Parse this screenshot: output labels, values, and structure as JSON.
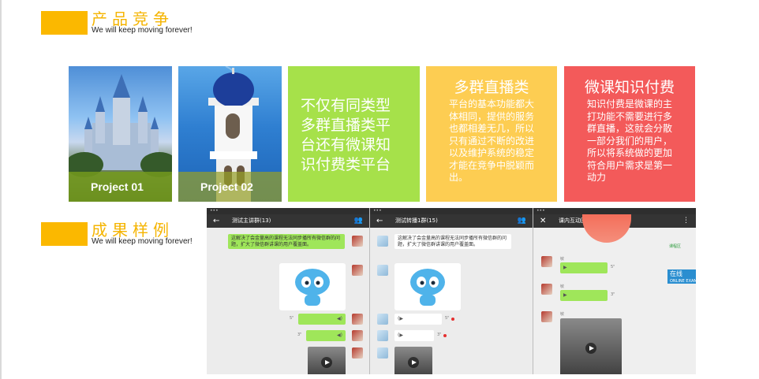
{
  "sections": [
    {
      "title": "产品竞争",
      "subtitle": "We will keep moving forever!"
    },
    {
      "title": "成果样例",
      "subtitle": "We will keep moving forever!"
    }
  ],
  "projects": [
    {
      "label": "Project 01"
    },
    {
      "label": "Project 02"
    }
  ],
  "tiles": {
    "green": {
      "text": "不仅有同类型多群直播类平台还有微课知识付费类平台",
      "color": "#a6e14a"
    },
    "yellow": {
      "title": "多群直播类",
      "text": "平台的基本功能都大体相同，提供的服务也都相差无几，所以只有通过不断的改进以及维护系统的稳定才能在竞争中脱颖而出。",
      "color": "#fdcd52"
    },
    "red": {
      "title": "微课知识付费",
      "text": "知识付费是微课的主打功能不需要进行多群直播，这就会分散一部分我们的用户，所以将系统做的更加符合用户需求是第一动力",
      "color": "#f35a5a"
    }
  },
  "accent_color": "#fbb800",
  "chat": {
    "pane1": {
      "title": "测试主讲群(13)",
      "message": "这解决了会金量高的课程无法同步播所有微信群的问题，扩大了微信群讲课的用户覆盖面。",
      "voice1": "5\"",
      "voice2": "3\""
    },
    "pane2": {
      "title": "测试转播1群(15)",
      "message": "这解决了会金量高的课程无法同步播所有微信群的问题，扩大了微信群讲课的用户覆盖面。",
      "voice1": "5\"",
      "voice2": "3\""
    },
    "pane3": {
      "title": "课内互动回放",
      "speaker": "敏",
      "voice1": "5\"",
      "voice2": "3\"",
      "tag": "课程区",
      "live": "在线",
      "live_sub": "ONLINE EXAM"
    }
  },
  "icons": [
    "back-arrow-icon",
    "people-icon",
    "close-icon",
    "more-icon",
    "speaker-icon",
    "play-icon"
  ]
}
